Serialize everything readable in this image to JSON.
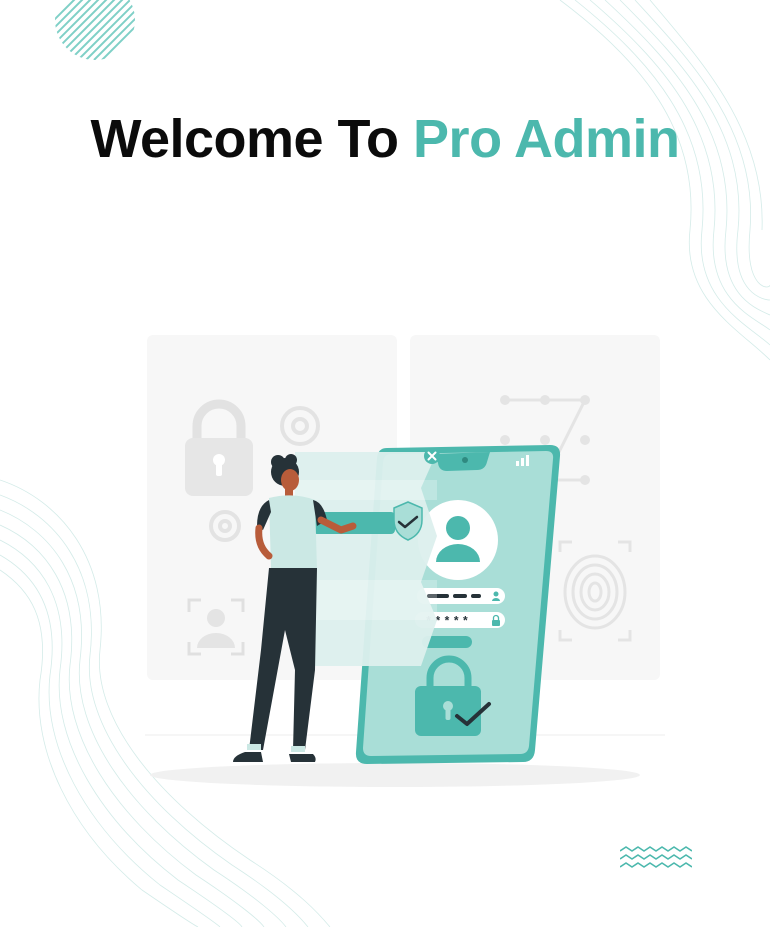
{
  "header": {
    "title_part1": "Welcome To",
    "title_part2": "Pro Admin"
  },
  "illustration": {
    "password_mask": "*****",
    "icons": [
      "lock-icon",
      "gear-icon",
      "face-id-icon",
      "fingerprint-icon",
      "pattern-lock-icon",
      "user-avatar-icon",
      "shield-check-icon",
      "close-icon",
      "signal-icon"
    ]
  },
  "colors": {
    "accent": "#4cb8ad",
    "accent_light": "#9ed8d1",
    "dark": "#0b0b0b",
    "character_dark": "#263238"
  }
}
